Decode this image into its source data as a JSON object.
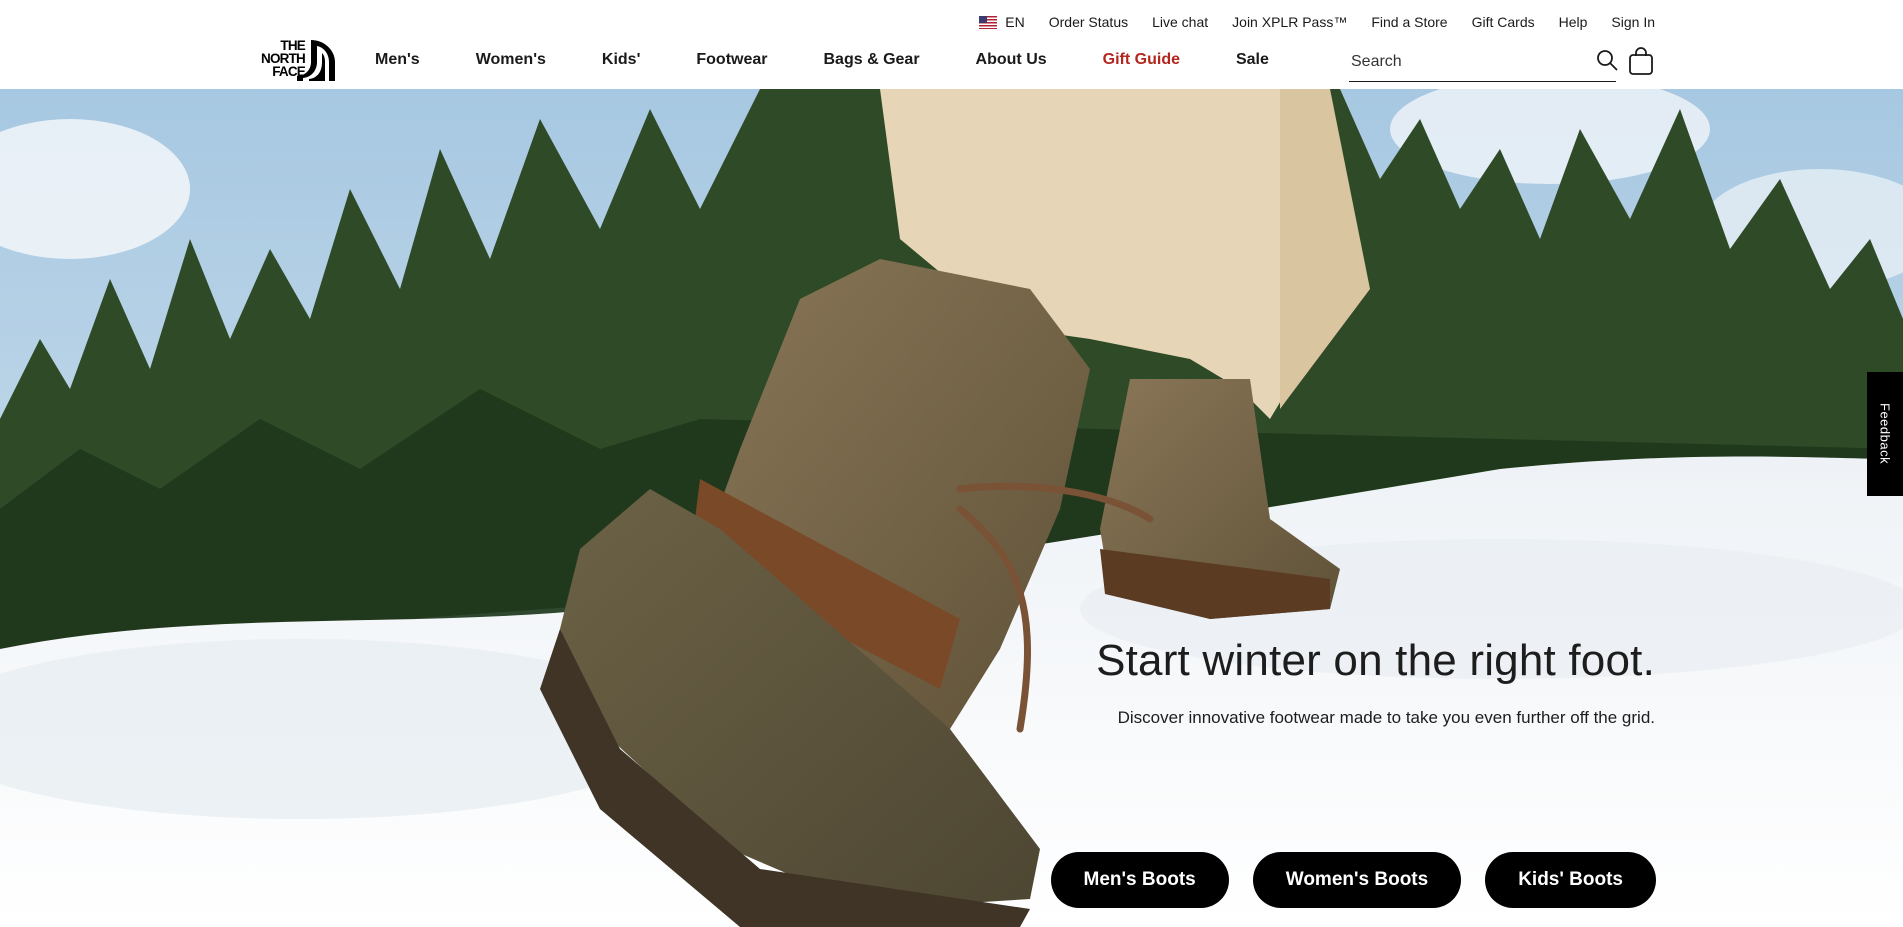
{
  "utility_nav": {
    "locale": "EN",
    "flag_icon": "us-flag-icon",
    "links": [
      "Order Status",
      "Live chat",
      "Join XPLR Pass™",
      "Find a Store",
      "Gift Cards",
      "Help",
      "Sign In"
    ]
  },
  "logo": {
    "text_line1": "THE",
    "text_line2": "NORTH",
    "text_line3": "FACE"
  },
  "main_nav": {
    "items": [
      "Men's",
      "Women's",
      "Kids'",
      "Footwear",
      "Bags & Gear",
      "About Us",
      "Gift Guide",
      "Sale"
    ],
    "highlight_color": "#b3261e"
  },
  "search": {
    "placeholder": "Search",
    "value": "",
    "icon": "search-icon"
  },
  "cart": {
    "icon": "shopping-bag-icon"
  },
  "hero": {
    "headline": "Start winter on the right foot.",
    "subline": "Discover innovative footwear made to take you even further off the grid.",
    "buttons": [
      "Men's Boots",
      "Women's Boots",
      "Kids' Boots"
    ]
  },
  "feedback": {
    "label": "Feedback"
  }
}
